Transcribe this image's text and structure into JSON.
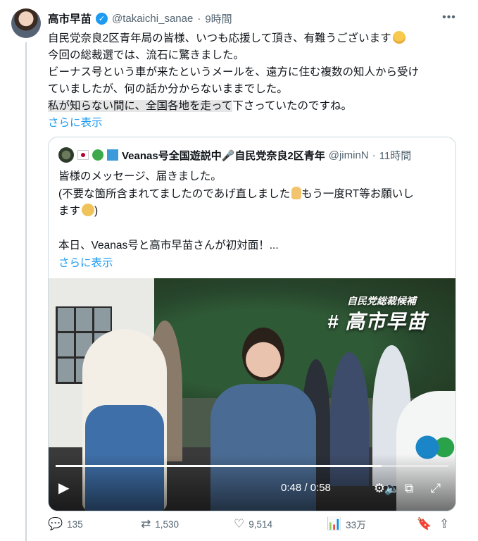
{
  "author": {
    "display_name": "高市早苗",
    "handle": "@takaichi_sanae",
    "separator": "·",
    "time_ago": "9時間",
    "verified_icon": "verified-badge-icon"
  },
  "tweet": {
    "lines": [
      "自民党奈良2区青年局の皆様、いつも応援して頂き、有難うございます",
      "今回の総裁選では、流石に驚きました。",
      "ビーナス号という車が来たというメールを、遠方に住む複数の知人から受け",
      "ていましたが、何の話か分からないままでした。"
    ],
    "highlight_part": "私が知らない間に、全国各地を走って",
    "rest_part": "下さっていたのですね。",
    "show_more": "さらに表示"
  },
  "quote": {
    "display_name": "Veanas号全国遊説中🎤自民党奈良2区青年",
    "handle": "@jiminN",
    "separator": "·",
    "time_ago": "11時間",
    "lines": [
      "皆様のメッセージ、届きました。",
      "(不要な箇所含まれてましたのであげ直しました",
      "もう一度RT等お願いし",
      "ます",
      ")",
      "",
      "本日、Veanas号と高市早苗さんが初対面！..."
    ],
    "show_more": "さらに表示",
    "video": {
      "overlay_subtitle": "自民党総裁候補",
      "overlay_title": "# 高市早苗",
      "time_display": "0:48 / 0:58",
      "progress_fraction": 0.83,
      "play_icon": "play-icon",
      "volume_icon": "volume-icon",
      "settings_icon": "settings-icon",
      "pip_icon": "picture-in-picture-icon",
      "fullscreen_icon": "fullscreen-icon"
    }
  },
  "actions": {
    "replies": "135",
    "retweets": "1,530",
    "likes": "9,514",
    "views": "33万"
  }
}
